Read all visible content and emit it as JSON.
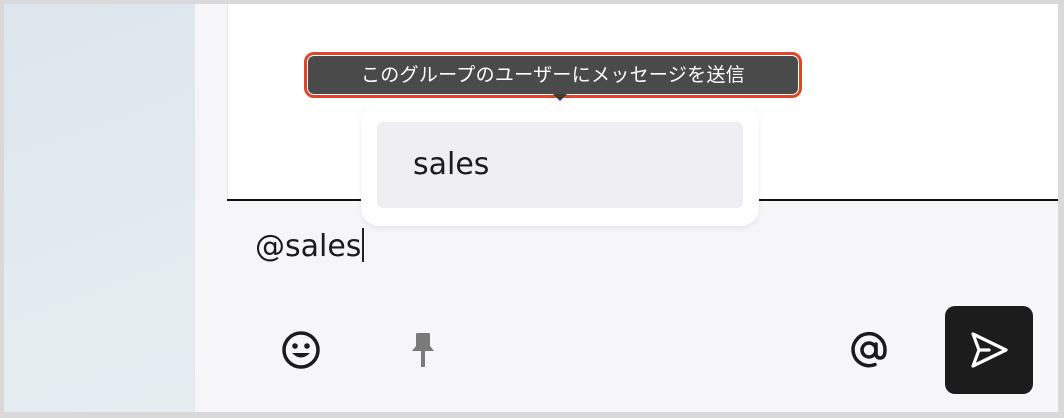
{
  "tooltip": {
    "text": "このグループのユーザーにメッセージを送信"
  },
  "mention_popup": {
    "items": [
      {
        "label": "sales"
      }
    ]
  },
  "composer": {
    "value": "@sales"
  },
  "toolbar": {
    "emoji_icon": "smile-face-icon",
    "pin_icon": "pushpin-icon",
    "mention_icon": "at-sign-icon",
    "send_icon": "paper-plane-icon"
  },
  "colors": {
    "highlight": "#e0452b",
    "send_bg": "#1c1c1c",
    "tooltip_bg": "#4a4a4a"
  }
}
